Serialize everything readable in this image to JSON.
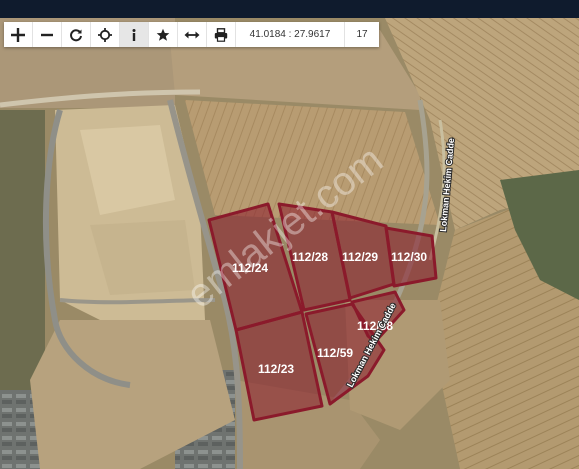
{
  "toolbar": {
    "coordinates": "41.0184 : 27.9617",
    "zoom": "17",
    "tools": [
      {
        "name": "zoom-in-icon"
      },
      {
        "name": "zoom-out-icon"
      },
      {
        "name": "refresh-icon"
      },
      {
        "name": "locate-icon"
      },
      {
        "name": "info-icon"
      },
      {
        "name": "star-icon"
      },
      {
        "name": "measure-icon"
      },
      {
        "name": "print-icon"
      }
    ]
  },
  "map": {
    "watermark": "emlakjet.com",
    "road_labels": [
      "Lokman Hekim Cadde",
      "Lokman Hekim Cadde"
    ],
    "parcels": [
      "112/24",
      "112/28",
      "112/29",
      "112/30",
      "112/58",
      "112/59",
      "112/23"
    ],
    "parcel_color": "#8b1a2b"
  }
}
